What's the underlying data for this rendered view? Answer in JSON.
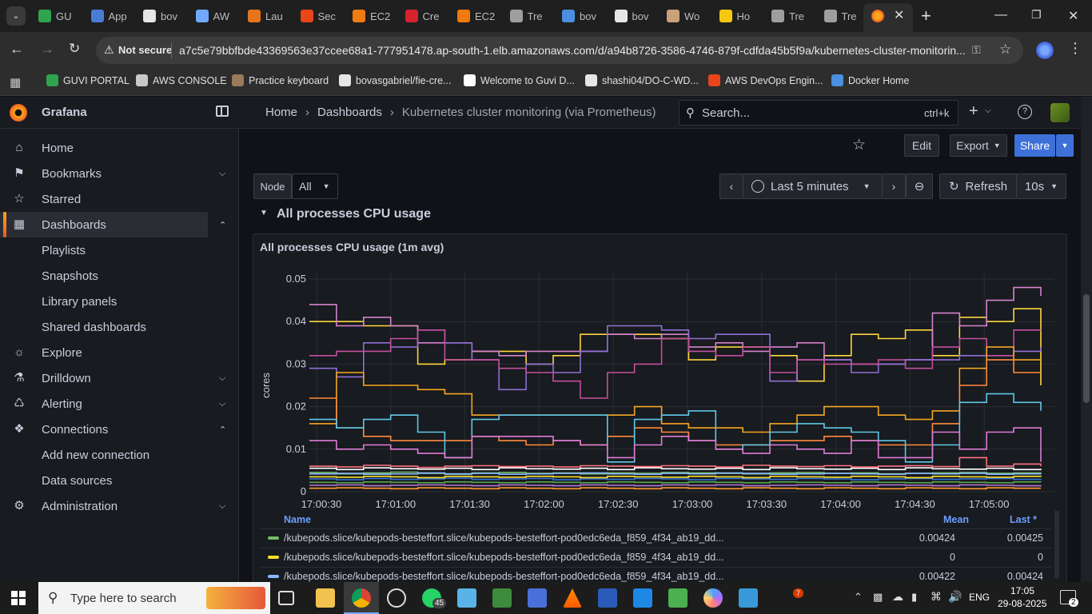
{
  "browser": {
    "tabs": [
      {
        "label": "GU",
        "color": "#2ea44f"
      },
      {
        "label": "App",
        "color": "#4a7bd8"
      },
      {
        "label": "bov",
        "color": "#e6e6e6"
      },
      {
        "label": "AW",
        "color": "#6fa8ff"
      },
      {
        "label": "Lau",
        "color": "#e8741a"
      },
      {
        "label": "Sec",
        "color": "#e8451a"
      },
      {
        "label": "EC2",
        "color": "#f07b0e"
      },
      {
        "label": "Cre",
        "color": "#d6222d"
      },
      {
        "label": "EC2",
        "color": "#f07b0e"
      },
      {
        "label": "Tre",
        "color": "#9e9e9e"
      },
      {
        "label": "bov",
        "color": "#4a8fe0"
      },
      {
        "label": "bov",
        "color": "#e6e6e6"
      },
      {
        "label": "Wo",
        "color": "#c9a27a"
      },
      {
        "label": "Ho",
        "color": "#f2c811"
      },
      {
        "label": "Tre",
        "color": "#9e9e9e"
      },
      {
        "label": "Tre",
        "color": "#9e9e9e"
      }
    ],
    "not_secure": "Not secure",
    "url": "a7c5e79bbfbde43369563e37ccee68a1-777951478.ap-south-1.elb.amazonaws.com/d/a94b8726-3586-4746-879f-cdfda45b5f9a/kubernetes-cluster-monitorin...",
    "bookmarks": [
      "GUVI PORTAL",
      "AWS CONSOLE",
      "Practice keyboard",
      "bovasgabriel/fie-cre...",
      "Welcome to Guvi D...",
      "shashi04/DO-C-WD...",
      "AWS DevOps Engin...",
      "Docker Home"
    ]
  },
  "grafana": {
    "brand": "Grafana",
    "breadcrumb": [
      "Home",
      "Dashboards",
      "Kubernetes cluster monitoring (via Prometheus)"
    ],
    "search_placeholder": "Search...",
    "search_shortcut": "ctrl+k",
    "nav": [
      {
        "label": "Home",
        "icon": "home-icon"
      },
      {
        "label": "Bookmarks",
        "icon": "bookmark-icon"
      },
      {
        "label": "Starred",
        "icon": "star-icon"
      },
      {
        "label": "Dashboards",
        "icon": "dashboards-icon"
      },
      {
        "label": "Playlists"
      },
      {
        "label": "Snapshots"
      },
      {
        "label": "Library panels"
      },
      {
        "label": "Shared dashboards"
      },
      {
        "label": "Explore",
        "icon": "compass-icon"
      },
      {
        "label": "Drilldown",
        "icon": "drilldown-icon"
      },
      {
        "label": "Alerting",
        "icon": "bell-icon"
      },
      {
        "label": "Connections",
        "icon": "connections-icon"
      },
      {
        "label": "Add new connection"
      },
      {
        "label": "Data sources"
      },
      {
        "label": "Administration",
        "icon": "gear-icon"
      }
    ],
    "toolbar": {
      "edit": "Edit",
      "export": "Export",
      "share": "Share"
    },
    "variable": {
      "label": "Node",
      "value": "All"
    },
    "time_range": "Last 5 minutes",
    "refresh": "Refresh",
    "refresh_interval": "10s",
    "row_title": "All processes CPU usage",
    "panel_title": "All processes CPU usage (1m avg)"
  },
  "chart_data": {
    "type": "line",
    "ylabel": "cores",
    "ylim": [
      0,
      0.05
    ],
    "yticks": [
      "0",
      "0.01",
      "0.02",
      "0.03",
      "0.04",
      "0.05"
    ],
    "xticks": [
      "17:00:30",
      "17:01:00",
      "17:01:30",
      "17:02:00",
      "17:02:30",
      "17:03:00",
      "17:03:30",
      "17:04:00",
      "17:04:30",
      "17:05:00"
    ],
    "series": [
      {
        "color": "#ffd53f",
        "values": [
          0.04,
          0.04,
          0.039,
          0.039,
          0.03,
          0.031,
          0.033,
          0.033,
          0.03,
          0.032,
          0.037,
          0.037,
          0.037,
          0.036,
          0.031,
          0.034,
          0.034,
          0.032,
          0.026,
          0.032,
          0.037,
          0.036,
          0.038,
          0.032,
          0.041,
          0.04,
          0.043,
          0.025
        ]
      },
      {
        "color": "#d683ce",
        "values": [
          0.044,
          0.039,
          0.041,
          0.039,
          0.035,
          0.035,
          0.033,
          0.032,
          0.033,
          0.033,
          0.033,
          0.037,
          0.036,
          0.037,
          0.034,
          0.035,
          0.033,
          0.034,
          0.035,
          0.031,
          0.03,
          0.03,
          0.031,
          0.042,
          0.039,
          0.045,
          0.048,
          0.046
        ]
      },
      {
        "color": "#8f6fd6",
        "values": [
          0.029,
          0.027,
          0.035,
          0.034,
          0.038,
          0.035,
          0.031,
          0.024,
          0.03,
          0.028,
          0.033,
          0.039,
          0.039,
          0.038,
          0.036,
          0.037,
          0.037,
          0.026,
          0.031,
          0.031,
          0.028,
          0.03,
          0.031,
          0.031,
          0.032,
          0.032,
          0.033,
          0.034
        ]
      },
      {
        "color": "#c44e9e",
        "values": [
          0.032,
          0.033,
          0.033,
          0.036,
          0.038,
          0.031,
          0.031,
          0.029,
          0.028,
          0.026,
          0.022,
          0.028,
          0.03,
          0.036,
          0.033,
          0.032,
          0.034,
          0.028,
          0.031,
          0.03,
          0.03,
          0.031,
          0.029,
          0.034,
          0.036,
          0.032,
          0.038,
          0.038
        ]
      },
      {
        "color": "#f5a623",
        "values": [
          0.016,
          0.028,
          0.025,
          0.025,
          0.024,
          0.023,
          0.018,
          0.018,
          0.018,
          0.018,
          0.018,
          0.018,
          0.02,
          0.016,
          0.015,
          0.015,
          0.014,
          0.016,
          0.018,
          0.02,
          0.02,
          0.018,
          0.017,
          0.019,
          0.029,
          0.034,
          0.031,
          0.031
        ]
      },
      {
        "color": "#ff8a3d",
        "values": [
          0.022,
          0.015,
          0.013,
          0.012,
          0.012,
          0.012,
          0.013,
          0.012,
          0.011,
          0.012,
          0.011,
          0.013,
          0.015,
          0.014,
          0.012,
          0.011,
          0.011,
          0.012,
          0.012,
          0.013,
          0.012,
          0.011,
          0.011,
          0.016,
          0.025,
          0.031,
          0.028,
          0.028
        ]
      },
      {
        "color": "#5ec8e8",
        "values": [
          0.017,
          0.015,
          0.017,
          0.018,
          0.014,
          0.008,
          0.017,
          0.018,
          0.018,
          0.018,
          0.018,
          0.007,
          0.017,
          0.018,
          0.019,
          0.01,
          0.011,
          0.014,
          0.016,
          0.015,
          0.014,
          0.012,
          0.007,
          0.011,
          0.021,
          0.023,
          0.021,
          0.019
        ]
      },
      {
        "color": "#e07bd8",
        "values": [
          0.012,
          0.01,
          0.011,
          0.01,
          0.009,
          0.008,
          0.013,
          0.013,
          0.013,
          0.012,
          0.011,
          0.008,
          0.011,
          0.013,
          0.012,
          0.01,
          0.009,
          0.011,
          0.01,
          0.009,
          0.012,
          0.008,
          0.008,
          0.014,
          0.01,
          0.014,
          0.015,
          0.007
        ]
      },
      {
        "color": "#73bf69",
        "values": [
          0.0045,
          0.0042,
          0.0044,
          0.0046,
          0.0043,
          0.0041,
          0.0044,
          0.0045,
          0.0043,
          0.0044,
          0.0042,
          0.0044,
          0.0043,
          0.0045,
          0.0044,
          0.0043,
          0.0042,
          0.0044,
          0.0045,
          0.0043,
          0.0044,
          0.0042,
          0.0043,
          0.0044,
          0.0045,
          0.0043,
          0.0044,
          0.00425
        ]
      },
      {
        "color": "#8ab8ff",
        "values": [
          0.0042,
          0.0043,
          0.0041,
          0.0042,
          0.0044,
          0.0042,
          0.0043,
          0.0041,
          0.0042,
          0.0043,
          0.0044,
          0.0042,
          0.0041,
          0.0043,
          0.0042,
          0.0044,
          0.0043,
          0.0041,
          0.0042,
          0.0043,
          0.0042,
          0.0041,
          0.0043,
          0.0042,
          0.0043,
          0.0041,
          0.0042,
          0.00424
        ]
      },
      {
        "color": "#ffffff",
        "values": [
          0.0055,
          0.0052,
          0.0056,
          0.0054,
          0.0053,
          0.0055,
          0.0052,
          0.0056,
          0.0054,
          0.0053,
          0.0055,
          0.0052,
          0.0056,
          0.0054,
          0.0053,
          0.0055,
          0.0052,
          0.0056,
          0.0054,
          0.0053,
          0.0055,
          0.0052,
          0.0056,
          0.0054,
          0.0053,
          0.0055,
          0.0052,
          0.0054
        ]
      },
      {
        "color": "#ff7383",
        "values": [
          0.006,
          0.0058,
          0.0062,
          0.006,
          0.0057,
          0.006,
          0.0061,
          0.0059,
          0.006,
          0.0058,
          0.0061,
          0.006,
          0.0059,
          0.0061,
          0.006,
          0.0058,
          0.0062,
          0.006,
          0.0059,
          0.0061,
          0.0058,
          0.006,
          0.0061,
          0.0059,
          0.008,
          0.006,
          0.0065,
          0.006
        ]
      },
      {
        "color": "#3274d9",
        "values": [
          0.003,
          0.0028,
          0.0031,
          0.0029,
          0.003,
          0.0032,
          0.0029,
          0.003,
          0.0031,
          0.0028,
          0.003,
          0.0029,
          0.0031,
          0.003,
          0.0028,
          0.0031,
          0.003,
          0.0029,
          0.0031,
          0.003,
          0.0028,
          0.003,
          0.0031,
          0.0029,
          0.003,
          0.0031,
          0.0029,
          0.003
        ]
      },
      {
        "color": "#fade2a",
        "values": [
          0.0035,
          0.0034,
          0.0036,
          0.0035,
          0.0033,
          0.0036,
          0.0035,
          0.0034,
          0.0036,
          0.0035,
          0.0033,
          0.0036,
          0.0035,
          0.0034,
          0.0036,
          0.0035,
          0.0033,
          0.0036,
          0.0035,
          0.0034,
          0.0036,
          0.0035,
          0.0033,
          0.0036,
          0.0035,
          0.0034,
          0.0036,
          0.0035
        ]
      },
      {
        "color": "#b877d9",
        "values": [
          0.0015,
          0.0016,
          0.0014,
          0.0015,
          0.0016,
          0.0015,
          0.0014,
          0.0016,
          0.0015,
          0.0014,
          0.0016,
          0.0015,
          0.0014,
          0.0016,
          0.0015,
          0.0016,
          0.0014,
          0.0015,
          0.0016,
          0.0015,
          0.0014,
          0.0016,
          0.0015,
          0.0014,
          0.0016,
          0.0015,
          0.0014,
          0.0015
        ]
      },
      {
        "color": "#56a64b",
        "values": [
          0.0022,
          0.0021,
          0.0023,
          0.0022,
          0.0021,
          0.0023,
          0.0022,
          0.0021,
          0.0023,
          0.0022,
          0.0021,
          0.0023,
          0.0022,
          0.0021,
          0.0023,
          0.0022,
          0.0021,
          0.0023,
          0.0022,
          0.0021,
          0.0023,
          0.0022,
          0.0021,
          0.0023,
          0.0022,
          0.0021,
          0.0023,
          0.0022
        ]
      },
      {
        "color": "#ff9830",
        "values": [
          0.0008,
          0.0009,
          0.0008,
          0.0007,
          0.0009,
          0.0008,
          0.0007,
          0.0009,
          0.0008,
          0.0007,
          0.0009,
          0.0008,
          0.0007,
          0.0009,
          0.0008,
          0.0007,
          0.0009,
          0.0008,
          0.0007,
          0.0009,
          0.0008,
          0.0007,
          0.0009,
          0.0008,
          0.0007,
          0.0009,
          0.0008,
          0.0008
        ]
      }
    ],
    "legend": {
      "columns": [
        "Name",
        "Mean",
        "Last *"
      ],
      "rows": [
        {
          "color": "#73bf69",
          "name": "/kubepods.slice/kubepods-besteffort.slice/kubepods-besteffort-pod0edc6eda_f859_4f34_ab19_dd...",
          "mean": "0.00424",
          "last": "0.00425"
        },
        {
          "color": "#fade2a",
          "name": "/kubepods.slice/kubepods-besteffort.slice/kubepods-besteffort-pod0edc6eda_f859_4f34_ab19_dd...",
          "mean": "0",
          "last": "0"
        },
        {
          "color": "#8ab8ff",
          "name": "/kubepods.slice/kubepods-besteffort.slice/kubepods-besteffort-pod0edc6eda_f859_4f34_ab19_dd...",
          "mean": "0.00422",
          "last": "0.00424"
        }
      ]
    }
  },
  "taskbar": {
    "search_placeholder": "Type here to search",
    "whatsapp_badge": "45",
    "notify_badge": "7",
    "lang": "ENG",
    "time": "17:05",
    "date": "29-08-2025",
    "notif_count": "2"
  }
}
